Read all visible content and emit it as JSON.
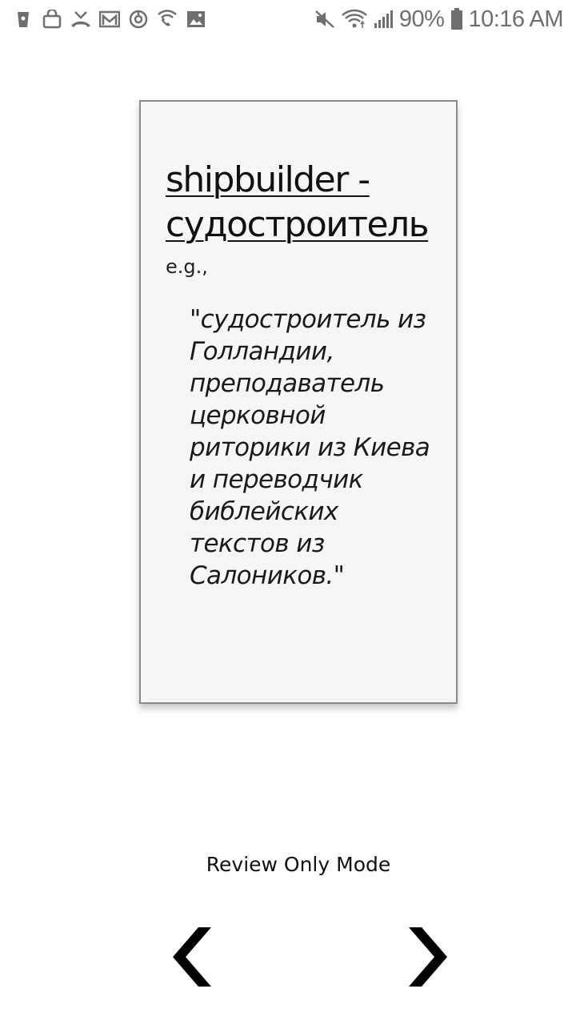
{
  "status_bar": {
    "left_icons": [
      "coffee-cup-icon",
      "shopping-bag-icon",
      "missed-call-icon",
      "gmail-icon",
      "sync-circle-icon",
      "wifi-calling-icon",
      "image-icon"
    ],
    "right_icons": [
      "mute-icon",
      "wifi-icon",
      "signal-icon",
      "battery-icon"
    ],
    "battery_percent": "90%",
    "time": "10:16 AM",
    "icon_color": "#6f6f6f"
  },
  "card": {
    "term": "shipbuilder -\nсудостроитель",
    "example_intro": "e.g.,",
    "example_text": "\"судостроитель из Голландии, преподаватель церковной риторики из Киева и переводчик библейских текстов из Салоников.\"",
    "background": "#f6f6f6",
    "border_color": "#8a8a8a"
  },
  "controls": {
    "mode_label": "Review Only Mode",
    "prev_icon": "chevron-left-icon",
    "next_icon": "chevron-right-icon"
  }
}
